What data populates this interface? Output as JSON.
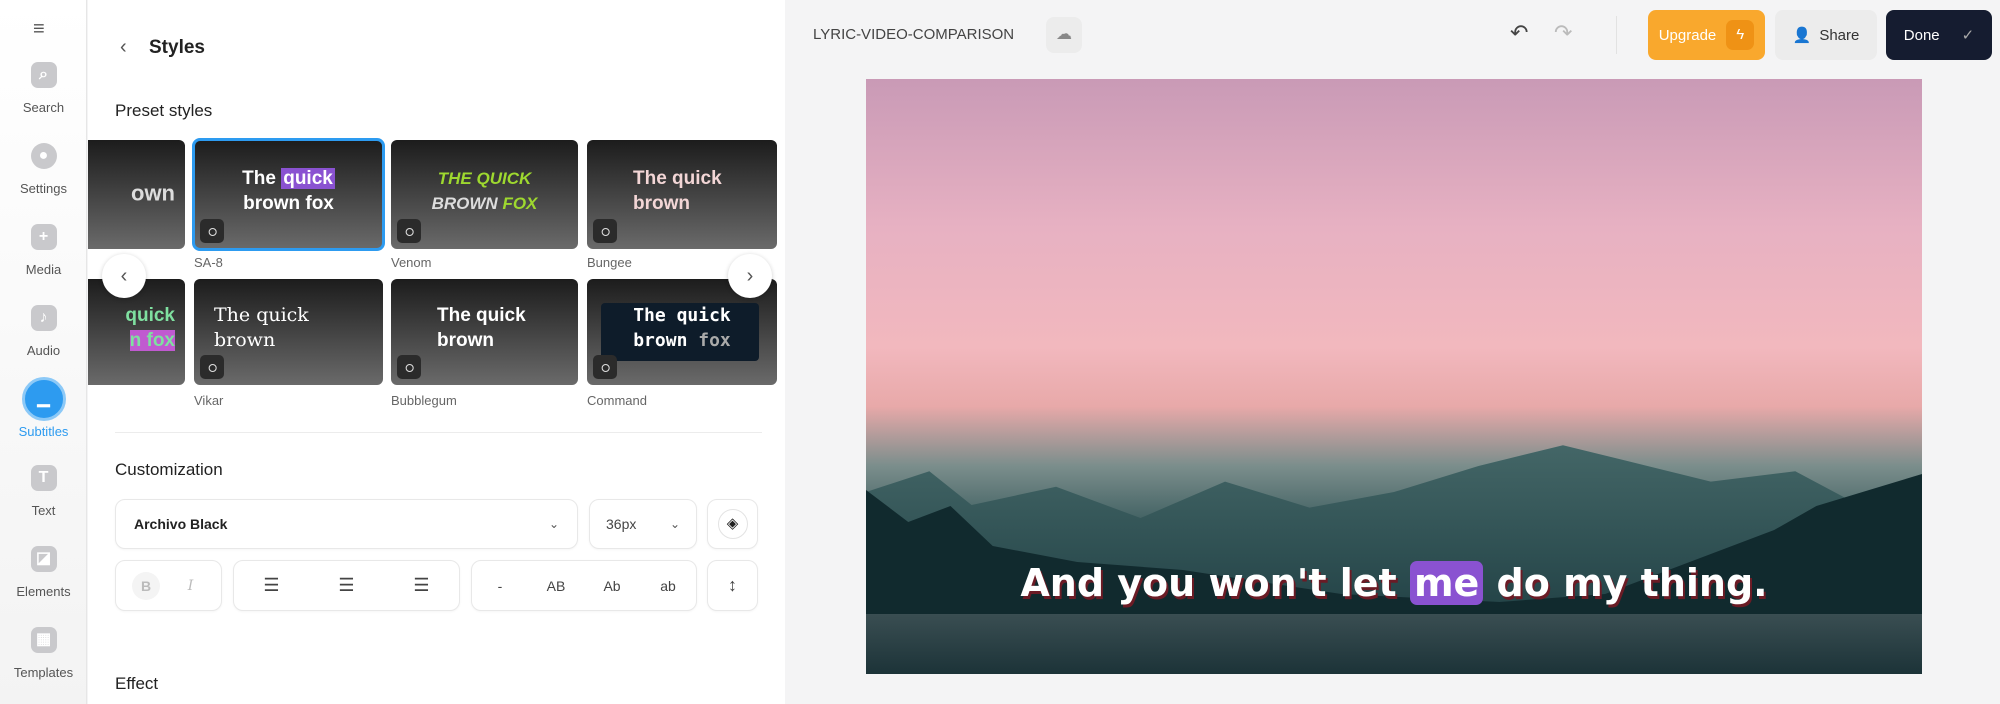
{
  "sidebar": {
    "items": [
      {
        "label": "Search",
        "icon": "search-icon",
        "glyph": "⌕"
      },
      {
        "label": "Settings",
        "icon": "gear-icon",
        "glyph": "●"
      },
      {
        "label": "Media",
        "icon": "plus-icon",
        "glyph": "+"
      },
      {
        "label": "Audio",
        "icon": "music-note-icon",
        "glyph": "♪"
      },
      {
        "label": "Subtitles",
        "icon": "subtitles-icon",
        "glyph": "▁"
      },
      {
        "label": "Text",
        "icon": "text-icon",
        "glyph": "T"
      },
      {
        "label": "Elements",
        "icon": "elements-icon",
        "glyph": "◪"
      },
      {
        "label": "Templates",
        "icon": "templates-icon",
        "glyph": "▦"
      }
    ],
    "active": "Subtitles"
  },
  "panel": {
    "title": "Styles",
    "preset_heading": "Preset styles",
    "presets": [
      {
        "name": "",
        "preview": "own"
      },
      {
        "name": "SA-8",
        "preview_a": "The ",
        "preview_hl": "quick",
        "preview_b": "brown fox",
        "selected": true
      },
      {
        "name": "Venom",
        "preview_a": "THE QUICK",
        "preview_b": "BROWN ",
        "preview_c": "FOX"
      },
      {
        "name": "Bungee",
        "preview_a": "The quick",
        "preview_b": "brown"
      },
      {
        "name": "",
        "preview_a": "quick",
        "preview_b": "n fox"
      },
      {
        "name": "Vikar",
        "preview_a": "The quick",
        "preview_b": "brown"
      },
      {
        "name": "Bubblegum",
        "preview_a": "The quick",
        "preview_b": "brown"
      },
      {
        "name": "Command",
        "preview_a": "The quick",
        "preview_b": "brown ",
        "preview_c": "fox"
      }
    ],
    "customization_heading": "Customization",
    "font": "Archivo Black",
    "font_size": "36px",
    "case_options": [
      "-",
      "AB",
      "Ab",
      "ab"
    ],
    "bold": "B",
    "italic": "I",
    "effect_heading": "Effect"
  },
  "topbar": {
    "project_title": "LYRIC-VIDEO-COMPARISON",
    "upgrade": "Upgrade",
    "share": "Share",
    "done": "Done"
  },
  "video": {
    "subtitle_before": "And you won't let ",
    "subtitle_highlight": "me",
    "subtitle_after": " do my thing.",
    "highlight_color": "#8a52d1"
  },
  "colors": {
    "accent": "#2d9bf0",
    "upgrade": "#f9a82d",
    "done": "#151c30"
  }
}
